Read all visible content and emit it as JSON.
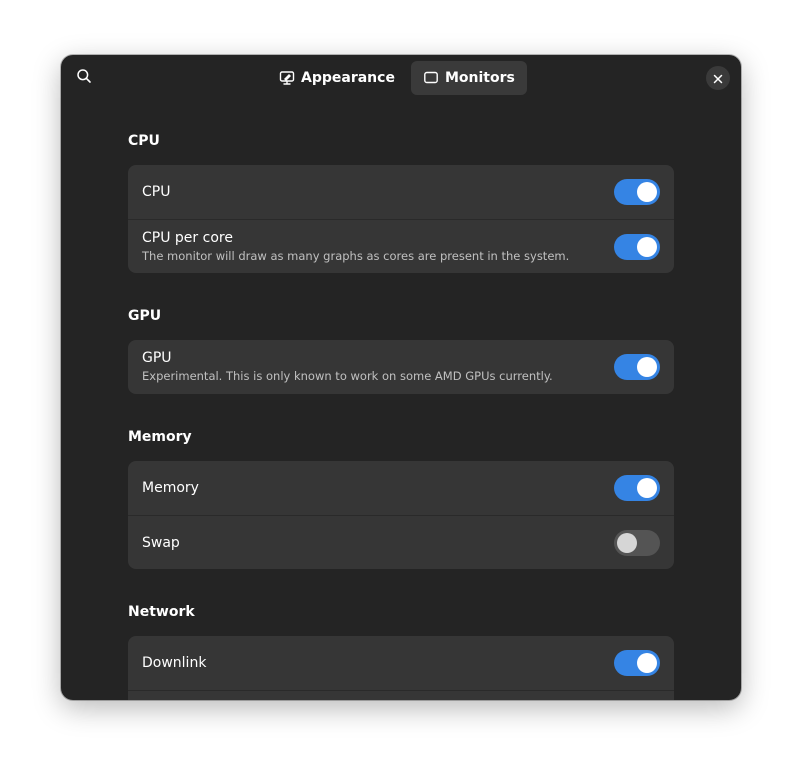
{
  "header": {
    "search_icon": "search-icon",
    "tabs": [
      {
        "label": "Appearance",
        "icon": "appearance-icon",
        "active": false
      },
      {
        "label": "Monitors",
        "icon": "monitor-icon",
        "active": true
      }
    ],
    "close_icon": "close-icon"
  },
  "sections": {
    "cpu": {
      "title": "CPU",
      "rows": [
        {
          "title": "CPU",
          "enabled": true
        },
        {
          "title": "CPU per core",
          "subtitle": "The monitor will draw as many graphs as cores are present in the system.",
          "enabled": true
        }
      ]
    },
    "gpu": {
      "title": "GPU",
      "rows": [
        {
          "title": "GPU",
          "subtitle": "Experimental. This is only known to work on some AMD GPUs currently.",
          "enabled": true
        }
      ]
    },
    "memory": {
      "title": "Memory",
      "rows": [
        {
          "title": "Memory",
          "enabled": true
        },
        {
          "title": "Swap",
          "enabled": false
        }
      ]
    },
    "network": {
      "title": "Network",
      "rows": [
        {
          "title": "Downlink",
          "enabled": true
        },
        {
          "title": "",
          "enabled": true
        }
      ]
    }
  },
  "colors": {
    "accent": "#3584e4",
    "window_bg": "#242424",
    "card_bg": "#363636"
  }
}
